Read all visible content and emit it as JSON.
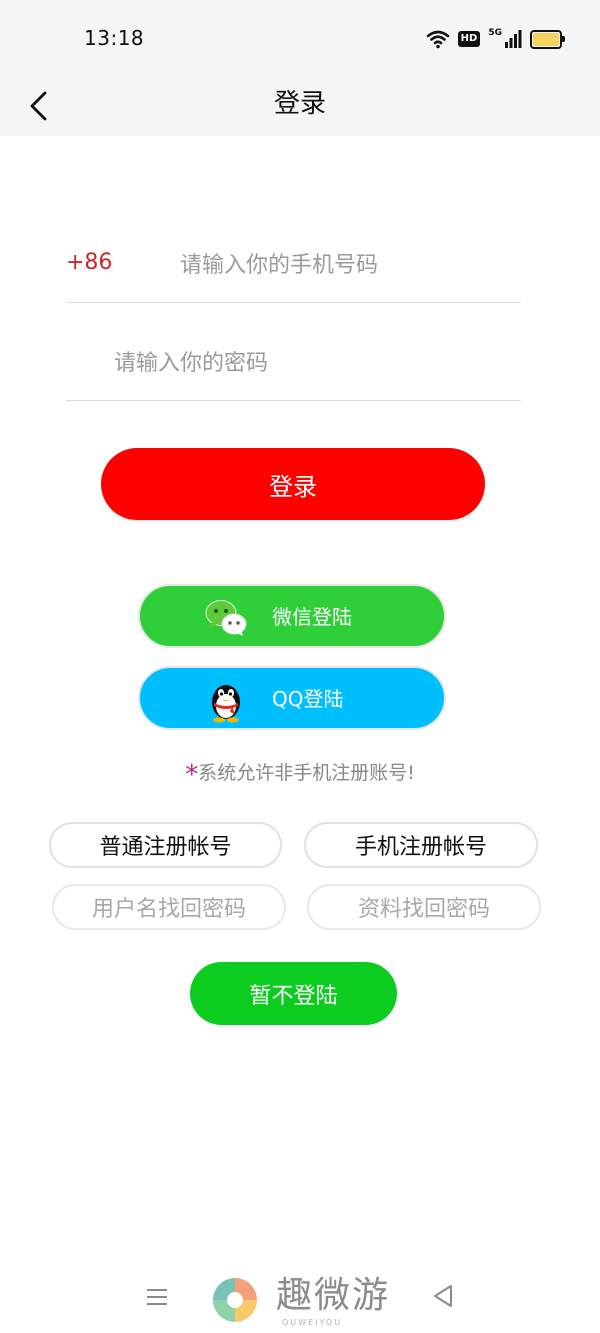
{
  "status_bar": {
    "time": "13:18",
    "hd_label": "HD",
    "network_label": "5G",
    "icons": [
      "wifi-icon",
      "signal-icon",
      "battery-icon"
    ]
  },
  "header": {
    "title": "登录",
    "back_icon": "chevron-left-icon"
  },
  "form": {
    "country_code": "+86",
    "phone_placeholder": "请输入你的手机号码",
    "password_placeholder": "请输入你的密码",
    "login_label": "登录"
  },
  "social": {
    "wechat_label": "微信登陆",
    "qq_label": "QQ登陆"
  },
  "notice": {
    "star": "*",
    "text": "系统允许非手机注册账号!"
  },
  "links": {
    "normal_register": "普通注册帐号",
    "phone_register": "手机注册帐号",
    "username_recover": "用户名找回密码",
    "info_recover": "资料找回密码"
  },
  "skip_label": "暂不登陆",
  "watermark": {
    "name": "趣微游",
    "sub": "QUWEIYOU"
  },
  "colors": {
    "login_button": "#ff0000",
    "wechat_button": "#2fcf3a",
    "qq_button": "#00bfff",
    "skip_button": "#0ccd1f",
    "country_code": "#c8282a",
    "notice_star": "#c0268a"
  }
}
